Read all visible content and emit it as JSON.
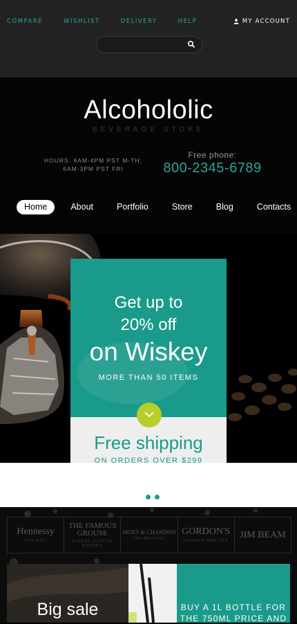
{
  "topbar": {
    "links": [
      "COMPARE",
      "WISHLIST",
      "DELIVERY",
      "HELP"
    ],
    "account_label": "MY ACCOUNT",
    "search_placeholder": ""
  },
  "header": {
    "logo": "Alcohololic",
    "tagline": "BEVERAGE STORE",
    "hours_line1": "HOURS: 6AM-4PM PST M-TH;",
    "hours_line2": "6AM-3PM PST FRI",
    "phone_label": "Free phone:",
    "phone": "800-2345-6789"
  },
  "nav": {
    "items": [
      "Home",
      "About",
      "Portfolio",
      "Store",
      "Blog",
      "Contacts"
    ],
    "active": "Home"
  },
  "hero": {
    "line1": "Get up to",
    "line2": "20% off",
    "line3": "on Wiskey",
    "sub": "MORE THAN 50 ITEMS",
    "shipping_title": "Free shipping",
    "shipping_sub": "ON ORDERS OVER $299"
  },
  "brands": [
    {
      "name": "Hennessy",
      "sub": "COGNAC"
    },
    {
      "name": "THE FAMOUS GROUSE",
      "sub": "FINEST SCOTCH WHISKY"
    },
    {
      "name": "MOET & CHANDON",
      "sub": "CHAMPAGNE"
    },
    {
      "name": "GORDON'S",
      "sub": "LONDON DRY GIN"
    },
    {
      "name": "JIM BEAM",
      "sub": ""
    }
  ],
  "bottom": {
    "big_sale": "Big sale",
    "promo_line1": "BUY A 1L BOTTLE FOR",
    "promo_line2": "THE 750ML PRICE AND"
  },
  "colors": {
    "accent": "#1a9a8a",
    "lime": "#b9ce2b",
    "link": "#2aa59a"
  }
}
